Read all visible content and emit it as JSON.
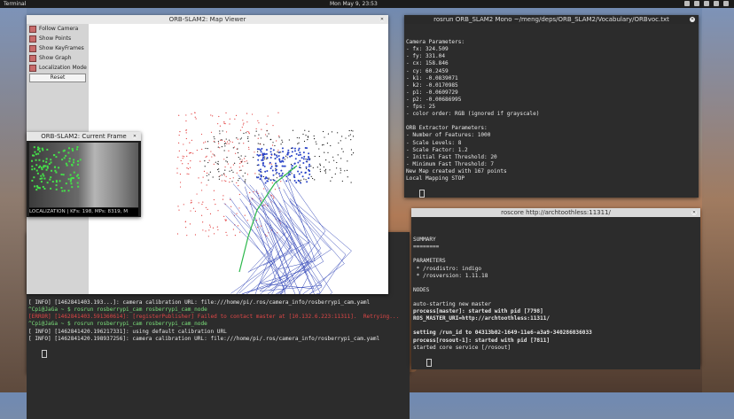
{
  "topbar": {
    "left": "Terminal",
    "datetime": "Mon May 9, 23:53"
  },
  "map_viewer": {
    "title": "ORB-SLAM2: Map Viewer",
    "options": [
      {
        "label": "Follow Camera",
        "checked": true
      },
      {
        "label": "Show Points",
        "checked": true
      },
      {
        "label": "Show KeyFrames",
        "checked": true
      },
      {
        "label": "Show Graph",
        "checked": true
      },
      {
        "label": "Localization Mode",
        "checked": true
      }
    ],
    "reset_label": "Reset"
  },
  "current_frame": {
    "title": "ORB-SLAM2: Current Frame",
    "status": "LOCALIZATION | KFs: 198, MPs: 8319, M"
  },
  "mono_terminal": {
    "title": "rosrun ORB_SLAM2 Mono ~/meng/deps/ORB_SLAM2/Vocabulary/ORBvoc.txt",
    "lines": [
      "Camera Parameters:",
      "- fx: 324.509",
      "- fy: 331.04",
      "- cx: 158.846",
      "- cy: 60.2459",
      "- k1: -0.0839071",
      "- k2: -0.0170985",
      "- p1: -0.0609729",
      "- p2: -0.00686995",
      "- fps: 25",
      "- color order: RGB (ignored if grayscale)",
      "",
      "ORB Extractor Parameters:",
      "- Number of Features: 1000",
      "- Scale Levels: 8",
      "- Scale Factor: 1.2",
      "- Initial Fast Threshold: 20",
      "- Minimum Fast Threshold: 7",
      "New Map created with 167 points",
      "Local Mapping STOP"
    ]
  },
  "roscore_terminal": {
    "title": "roscore http://archtoothless:11311/",
    "lines": [
      {
        "text": "SUMMARY",
        "style": ""
      },
      {
        "text": "========",
        "style": ""
      },
      {
        "text": "",
        "style": ""
      },
      {
        "text": "PARAMETERS",
        "style": ""
      },
      {
        "text": " * /rosdistro: indigo",
        "style": ""
      },
      {
        "text": " * /rosversion: 1.11.18",
        "style": ""
      },
      {
        "text": "",
        "style": ""
      },
      {
        "text": "NODES",
        "style": ""
      },
      {
        "text": "",
        "style": ""
      },
      {
        "text": "auto-starting new master",
        "style": ""
      },
      {
        "text": "process[master]: started with pid [7798]",
        "style": "bold"
      },
      {
        "text": "ROS_MASTER_URI=http://archtoothless:11311/",
        "style": "bold"
      },
      {
        "text": "",
        "style": ""
      },
      {
        "text": "setting /run_id to 04313b02-1649-11e6-a3a9-340286036033",
        "style": "bold"
      },
      {
        "text": "process[rosout-1]: started with pid [7811]",
        "style": "bold"
      },
      {
        "text": "started core service [/rosout]",
        "style": ""
      }
    ]
  },
  "bottom_terminal": {
    "lines": [
      {
        "text": "[ INFO] [1462841403.193...]: camera calibration URL: file:///home/pi/.ros/camera_info/rosberrypi_cam.yaml",
        "style": ""
      },
      {
        "text": "^Cpi@JaGa ~ $ rosrun rosberrypi_cam rosberrypi_cam_node",
        "style": "green"
      },
      {
        "text": "[ERROR] [1462841403.591360614]: [registerPublisher] Failed to contact master at [10.132.6.223:11311].  Retrying...",
        "style": "red"
      },
      {
        "text": "^Cpi@JaGa ~ $ rosrun rosberrypi_cam rosberrypi_cam_node",
        "style": "green"
      },
      {
        "text": "[ INFO] [1462841420.196217331]: using default calibration URL",
        "style": ""
      },
      {
        "text": "[ INFO] [1462841420.198937256]: camera calibration URL: file:///home/pi/.ros/camera_info/rosberrypi_cam.yaml",
        "style": ""
      }
    ]
  }
}
